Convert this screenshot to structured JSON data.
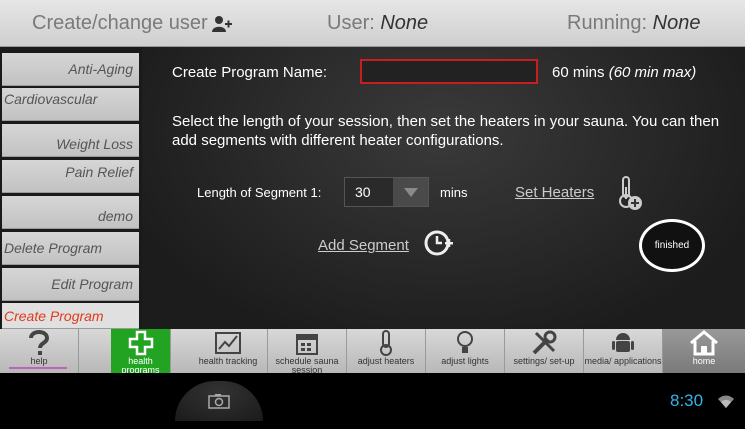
{
  "header": {
    "create_change_user": "Create/change user",
    "user_label": "User: ",
    "user_value": "None",
    "running_label": "Running: ",
    "running_value": "None"
  },
  "sidebar": {
    "items": [
      {
        "label": "Anti-Aging"
      },
      {
        "label": "Cardiovascular"
      },
      {
        "label": "Weight Loss"
      },
      {
        "label": "Pain Relief"
      },
      {
        "label": "demo"
      },
      {
        "label": "Delete Program"
      },
      {
        "label": "Edit Program"
      },
      {
        "label": "Create Program"
      }
    ]
  },
  "main": {
    "program_name_label": "Create Program Name:",
    "program_name_value": "",
    "duration": "60 mins ",
    "duration_max": "(60 min max)",
    "description": "Select the length of your session, then set the heaters in your sauna. You can then add segments with different heater configurations.",
    "segment_label": "Length of Segment 1:",
    "segment_value": "30",
    "segment_unit": "mins",
    "set_heaters": "Set Heaters",
    "add_segment": "Add Segment",
    "finished": "finished"
  },
  "iconbar": {
    "items": [
      {
        "label": "help"
      },
      {
        "label": "health programs"
      },
      {
        "label": "health tracking"
      },
      {
        "label": "schedule sauna session"
      },
      {
        "label": "adjust heaters"
      },
      {
        "label": "adjust lights"
      },
      {
        "label": "settings/ set-up"
      },
      {
        "label": "media/ applications"
      },
      {
        "label": "home"
      }
    ]
  },
  "system": {
    "time": "8:30"
  },
  "colors": {
    "accent_green": "#22a322",
    "active_red": "#e03a1a",
    "input_border": "#c81e1e",
    "clock_blue": "#33b5e5"
  }
}
